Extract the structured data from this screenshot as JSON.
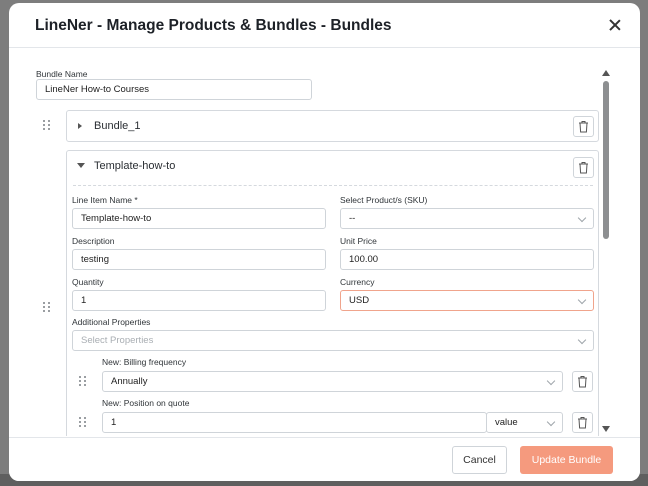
{
  "modal": {
    "title": "LineNer - Manage Products & Bundles - Bundles",
    "bundle_name_label": "Bundle Name",
    "bundle_name_value": "LineNer How-to Courses"
  },
  "bundles": [
    {
      "title": "Bundle_1",
      "expanded": false
    },
    {
      "title": "Template-how-to",
      "expanded": true
    }
  ],
  "line_item": {
    "name_label": "Line Item Name *",
    "name_value": "Template-how-to",
    "product_label": "Select Product/s (SKU)",
    "product_value": "--",
    "description_label": "Description",
    "description_value": "testing",
    "unit_price_label": "Unit Price",
    "unit_price_value": "100.00",
    "quantity_label": "Quantity",
    "quantity_value": "1",
    "currency_label": "Currency",
    "currency_value": "USD",
    "additional_properties_label": "Additional Properties",
    "additional_properties_placeholder": "Select Properties",
    "properties": [
      {
        "label": "New: Billing frequency",
        "value": "Annually"
      },
      {
        "label": "New: Position on quote",
        "value": "1",
        "type": "value"
      }
    ]
  },
  "footer": {
    "cancel_label": "Cancel",
    "update_label": "Update Bundle"
  },
  "colors": {
    "primary": "#f59a7e",
    "error_border": "#f0a48c",
    "backdrop": "#7d7d7d"
  }
}
